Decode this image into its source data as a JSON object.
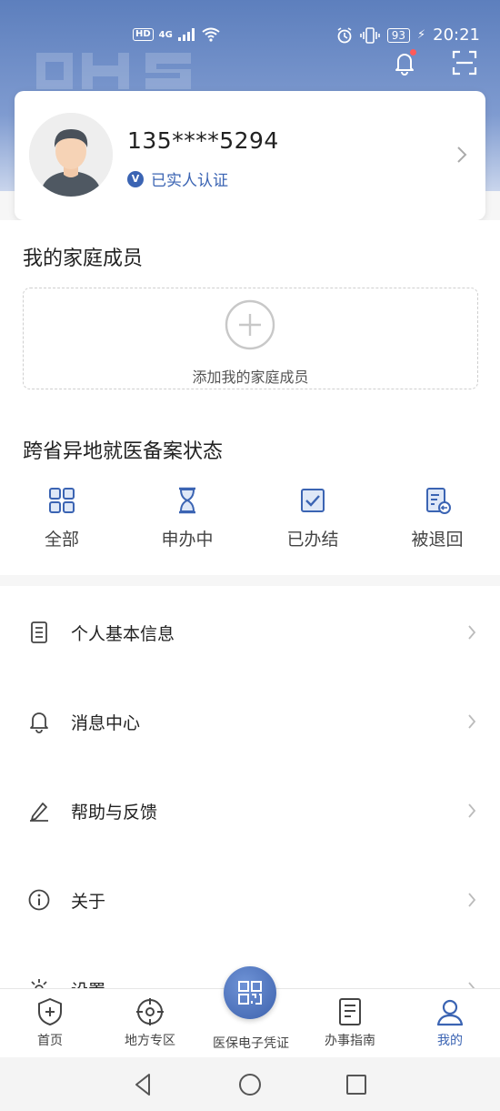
{
  "status_bar": {
    "hd": "HD",
    "network": "4G",
    "battery": "93",
    "time": "20:21"
  },
  "header": {
    "bell_icon": "bell-icon",
    "scan_icon": "scan-icon",
    "notification_dot_color": "#ff5a5a"
  },
  "profile": {
    "phone": "135****5294",
    "verified_label": "已实人认证",
    "verified_badge": "V"
  },
  "family": {
    "title": "我的家庭成员",
    "add_label": "添加我的家庭成员"
  },
  "filing_status": {
    "title": "跨省异地就医备案状态",
    "items": [
      {
        "label": "全部",
        "icon": "grid-icon"
      },
      {
        "label": "申办中",
        "icon": "hourglass-icon"
      },
      {
        "label": "已办结",
        "icon": "checkbox-icon"
      },
      {
        "label": "被退回",
        "icon": "document-return-icon"
      }
    ]
  },
  "menu": [
    {
      "label": "个人基本信息",
      "icon": "document-icon"
    },
    {
      "label": "消息中心",
      "icon": "bell-outline-icon"
    },
    {
      "label": "帮助与反馈",
      "icon": "pen-icon"
    },
    {
      "label": "关于",
      "icon": "info-icon"
    },
    {
      "label": "设置",
      "icon": "gear-icon"
    }
  ],
  "tabbar": {
    "tabs": [
      {
        "label": "首页",
        "icon": "shield-plus-icon"
      },
      {
        "label": "地方专区",
        "icon": "target-icon"
      },
      {
        "label": "医保电子凭证",
        "icon": "qr-code-icon"
      },
      {
        "label": "办事指南",
        "icon": "guide-icon"
      },
      {
        "label": "我的",
        "icon": "user-icon"
      }
    ],
    "active_index": 4
  },
  "colors": {
    "accent": "#3b64b3",
    "header_gradient_top": "#5d7fbd"
  }
}
